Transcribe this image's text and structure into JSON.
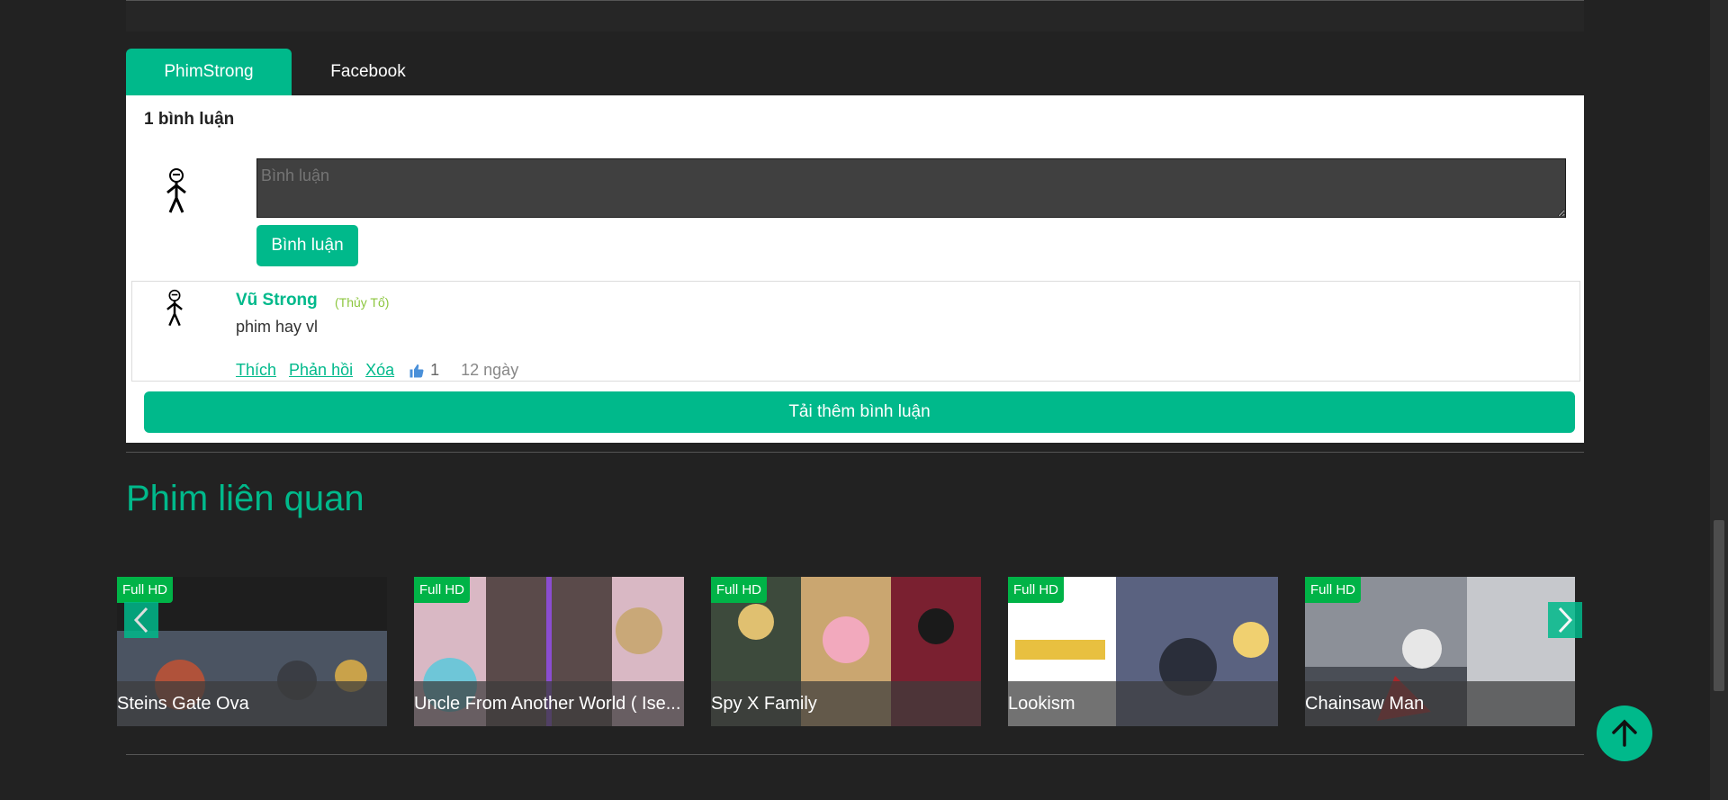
{
  "tabs": [
    {
      "label": "PhimStrong"
    },
    {
      "label": "Facebook"
    }
  ],
  "comments": {
    "count_label": "1 bình luận",
    "input_placeholder": "Bình luận",
    "submit_label": "Bình luận",
    "items": [
      {
        "author": "Vũ Strong",
        "rank": "(Thủy Tổ)",
        "text": "phim hay vl",
        "like_label": "Thích",
        "reply_label": "Phản hồi",
        "delete_label": "Xóa",
        "likes": "1",
        "time": "12 ngày"
      }
    ],
    "load_more_label": "Tải thêm bình luận"
  },
  "related": {
    "title": "Phim liên quan",
    "items": [
      {
        "badge": "Full HD",
        "title": "Steins Gate Ova",
        "color": "#6b7a8c"
      },
      {
        "badge": "Full HD",
        "title": "Uncle From Another World ( Ise...",
        "color": "#8a6a7d"
      },
      {
        "badge": "Full HD",
        "title": "Spy X Family",
        "color": "#7c4a3a"
      },
      {
        "badge": "Full HD",
        "title": "Lookism",
        "color": "#4e5a78"
      },
      {
        "badge": "Full HD",
        "title": "Chainsaw Man",
        "color": "#7a7f88"
      }
    ]
  },
  "colors": {
    "accent": "#00b98b",
    "badge": "#00b347",
    "background": "#222222"
  },
  "icons": {
    "prev": "chevron-left-icon",
    "next": "chevron-right-icon",
    "to_top": "arrow-up-icon",
    "like": "thumbs-up-icon"
  }
}
